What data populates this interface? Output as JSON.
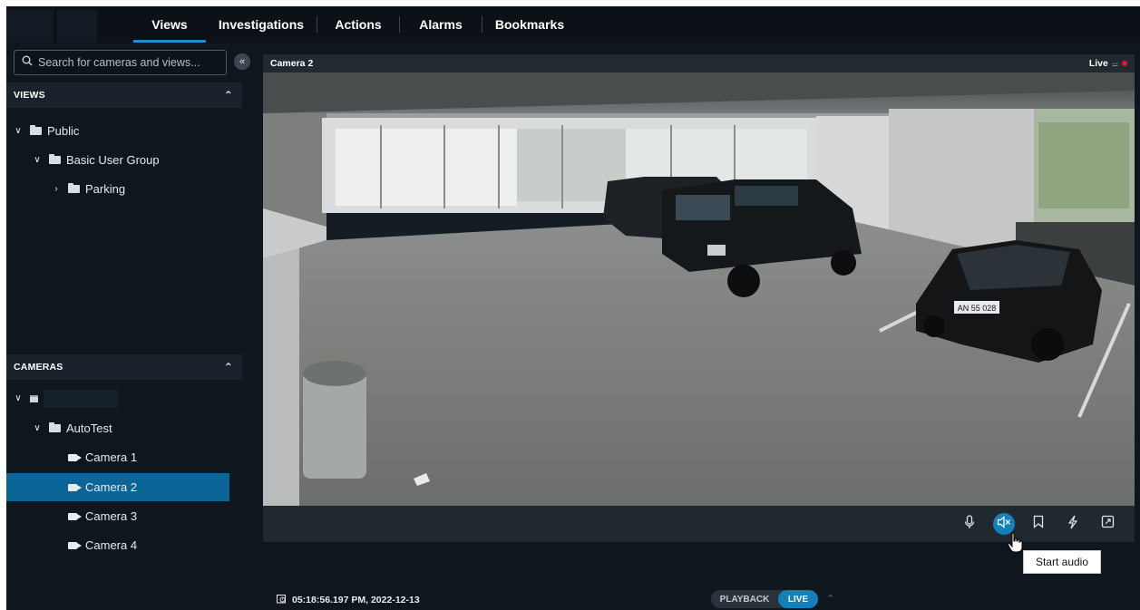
{
  "nav": {
    "tabs": [
      {
        "label": "Views",
        "active": true
      },
      {
        "label": "Investigations"
      },
      {
        "label": "Actions"
      },
      {
        "label": "Alarms"
      },
      {
        "label": "Bookmarks"
      }
    ]
  },
  "sidebar": {
    "search_placeholder": "Search for cameras and views...",
    "views_header": "VIEWS",
    "views_tree": [
      {
        "label": "Public",
        "level": 0,
        "expanded": true
      },
      {
        "label": "Basic User Group",
        "level": 1,
        "expanded": true
      },
      {
        "label": "Parking",
        "level": 2,
        "expanded": false
      }
    ],
    "cameras_header": "CAMERAS",
    "cameras_tree": [
      {
        "label": "AutoTest",
        "level": 1
      },
      {
        "label": "Camera 1",
        "level": 2
      },
      {
        "label": "Camera 2",
        "level": 2,
        "selected": true
      },
      {
        "label": "Camera 3",
        "level": 2
      },
      {
        "label": "Camera 4",
        "level": 2
      }
    ]
  },
  "viewer": {
    "camera_title": "Camera 2",
    "live_label": "Live",
    "plate_text": "AN 55 028",
    "tooltip": "Start audio",
    "controls": [
      "microphone-icon",
      "speaker-muted-icon",
      "bookmark-icon",
      "lightning-icon",
      "fullscreen-icon"
    ]
  },
  "bottom": {
    "timestamp": "05:18:56.197 PM, 2022-12-13",
    "playback_label": "PLAYBACK",
    "live_label": "LIVE"
  },
  "colors": {
    "accent": "#1480b8",
    "selected_row": "#0b6597",
    "background": "#0f171e",
    "live_dot": "#e0192a"
  }
}
